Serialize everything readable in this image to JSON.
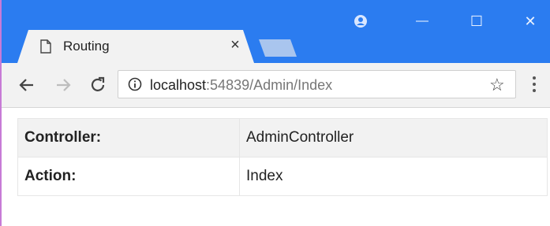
{
  "tab": {
    "title": "Routing",
    "close_label": "×",
    "page_icon": "document-icon"
  },
  "window_controls": {
    "profile_icon": "profile-icon",
    "minimize_label": "—",
    "maximize_label": "☐",
    "close_label": "✕"
  },
  "toolbar": {
    "back_icon": "back-arrow-icon",
    "forward_icon": "forward-arrow-icon",
    "reload_icon": "reload-icon",
    "url_host": "localhost",
    "url_rest": ":54839/Admin/Index",
    "bookmark_icon": "star-icon",
    "menu_icon": "menu-dots-icon"
  },
  "table": {
    "rows": [
      {
        "key": "Controller:",
        "value": "AdminController"
      },
      {
        "key": "Action:",
        "value": "Index"
      }
    ]
  },
  "colors": {
    "titlebar": "#2b7cf0",
    "tab": "#f2f2f2",
    "row_alt": "#f2f2f2"
  }
}
